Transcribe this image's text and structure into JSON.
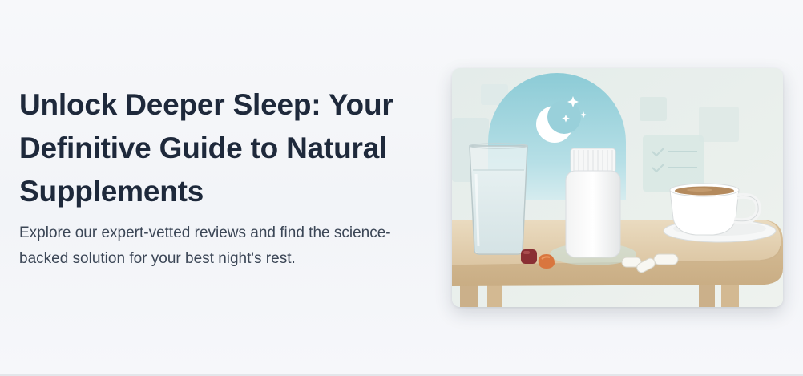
{
  "hero": {
    "title": "Unlock Deeper Sleep: Your Definitive Guide to Natural Supplements",
    "subtitle": "Explore our expert-vetted reviews and find the science-backed solution for your best night's rest."
  },
  "image": {
    "accent": "#9fd3dd",
    "wood": "#e5d3b6",
    "icons": [
      "moon-icon",
      "star-icon"
    ]
  }
}
